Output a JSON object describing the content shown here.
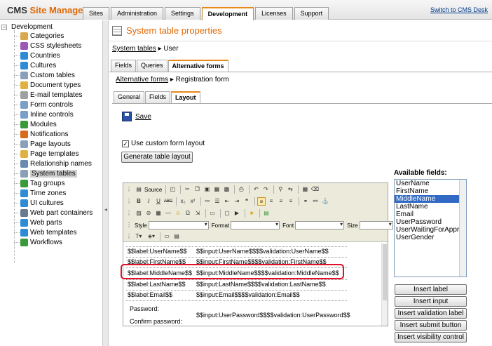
{
  "header": {
    "brand_prefix": "CMS",
    "brand_name": "Site Manager",
    "tabs": [
      {
        "label": "Sites"
      },
      {
        "label": "Administration"
      },
      {
        "label": "Settings"
      },
      {
        "label": "Development"
      },
      {
        "label": "Licenses"
      },
      {
        "label": "Support"
      }
    ],
    "active_tab": "Development",
    "switch_link": "Switch to CMS Desk"
  },
  "tree": {
    "root": "Development",
    "items": [
      {
        "label": "Categories",
        "icon": "categories-icon",
        "color": "#d8a84a"
      },
      {
        "label": "CSS stylesheets",
        "icon": "css-icon",
        "color": "#9b59b6"
      },
      {
        "label": "Countries",
        "icon": "globe-icon",
        "color": "#2e8bd6"
      },
      {
        "label": "Cultures",
        "icon": "globe-icon",
        "color": "#2e8bd6"
      },
      {
        "label": "Custom tables",
        "icon": "table-icon",
        "color": "#8aa0b8"
      },
      {
        "label": "Document types",
        "icon": "document-icon",
        "color": "#e0b040"
      },
      {
        "label": "E-mail templates",
        "icon": "email-icon",
        "color": "#a0a0a0"
      },
      {
        "label": "Form controls",
        "icon": "form-icon",
        "color": "#7aa0c8"
      },
      {
        "label": "Inline controls",
        "icon": "inline-icon",
        "color": "#7aa0c8"
      },
      {
        "label": "Modules",
        "icon": "module-icon",
        "color": "#3a9a3a"
      },
      {
        "label": "Notifications",
        "icon": "notification-icon",
        "color": "#d86a1a"
      },
      {
        "label": "Page layouts",
        "icon": "layout-icon",
        "color": "#8aa0b8"
      },
      {
        "label": "Page templates",
        "icon": "template-icon",
        "color": "#e0b040"
      },
      {
        "label": "Relationship names",
        "icon": "relationship-icon",
        "color": "#6a8ab0"
      },
      {
        "label": "System tables",
        "icon": "table-icon",
        "color": "#8aa0b8",
        "selected": true
      },
      {
        "label": "Tag groups",
        "icon": "tag-icon",
        "color": "#3a9a3a"
      },
      {
        "label": "Time zones",
        "icon": "clock-icon",
        "color": "#2e8bd6"
      },
      {
        "label": "UI cultures",
        "icon": "globe-icon",
        "color": "#2e8bd6"
      },
      {
        "label": "Web part containers",
        "icon": "container-icon",
        "color": "#6a7a90"
      },
      {
        "label": "Web parts",
        "icon": "webpart-icon",
        "color": "#2e8bd6"
      },
      {
        "label": "Web templates",
        "icon": "webtemplate-icon",
        "color": "#2e8bd6"
      },
      {
        "label": "Workflows",
        "icon": "workflow-icon",
        "color": "#3a9a3a"
      }
    ]
  },
  "main": {
    "title": "System table properties",
    "breadcrumb": {
      "link": "System tables",
      "current": "User"
    },
    "tabs": [
      {
        "label": "Fields"
      },
      {
        "label": "Queries"
      },
      {
        "label": "Alternative forms"
      }
    ],
    "active_tab": "Alternative forms",
    "sub_breadcrumb": {
      "link": "Alternative forms",
      "current": "Registration form"
    },
    "subtabs": [
      {
        "label": "General"
      },
      {
        "label": "Fields"
      },
      {
        "label": "Layout"
      }
    ],
    "active_subtab": "Layout",
    "save_label": "Save",
    "custom_layout_label": "Use custom form layout",
    "custom_layout_checked": true,
    "generate_button": "Generate table layout"
  },
  "editor": {
    "source_label": "Source",
    "style_label": "Style",
    "format_label": "Format",
    "font_label": "Font",
    "size_label": "Size",
    "rows": [
      {
        "label": "$$label:UserName$$",
        "input": "$$input:UserName$$$$validation:UserName$$"
      },
      {
        "label": "$$label:FirstName$$",
        "input": "$$input:FirstName$$$$validation:FirstName$$"
      },
      {
        "label": "$$label:MiddleName$$",
        "input": "$$input:MiddleName$$$$validation:MiddleName$$"
      },
      {
        "label": "$$label:LastName$$",
        "input": "$$input:LastName$$$$validation:LastName$$"
      },
      {
        "label": "$$label:Email$$",
        "input": "$$input:Email$$$$validation:Email$$"
      }
    ],
    "password_label": "Password:",
    "confirm_password_label": "Confirm password:",
    "password_input": "$$input:UserPassword$$$$validation:UserPassword$$"
  },
  "available": {
    "label": "Available fields:",
    "fields": [
      "UserName",
      "FirstName",
      "MiddleName",
      "LastName",
      "Email",
      "UserPassword",
      "UserWaitingForAppro",
      "UserGender"
    ],
    "selected": "MiddleName",
    "buttons": [
      "Insert label",
      "Insert input",
      "Insert validation label",
      "Insert submit button",
      "Insert visibility control"
    ]
  }
}
